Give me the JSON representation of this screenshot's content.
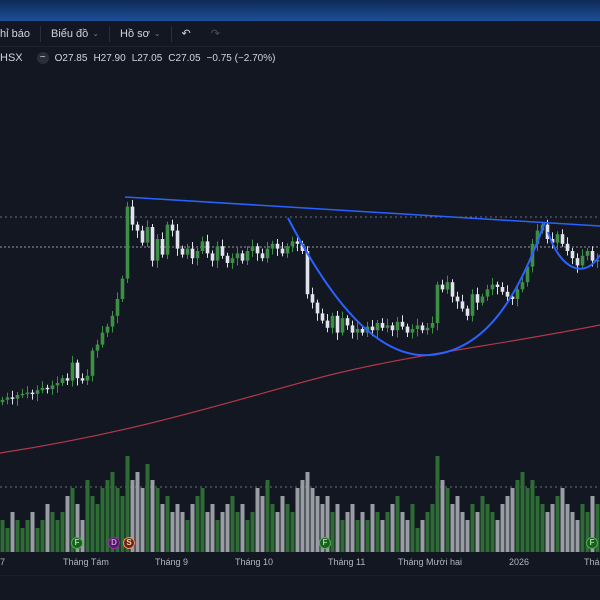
{
  "toolbar": {
    "indicators": "hỉ báo",
    "chart": "Biểu đồ",
    "profile": "Hồ sơ",
    "undo": "↶",
    "redo": "↷"
  },
  "legend": {
    "symbol": "HSX",
    "open": "O27.85",
    "high": "H27.90",
    "low": "L27.05",
    "close": "C27.05",
    "change": "−0.75 (−2.70%)"
  },
  "colors": {
    "up": "#3d8f46",
    "down": "#e0e3eb",
    "trend": "#2962ff",
    "ma": "#b2374a"
  },
  "x_axis": [
    "7",
    "Tháng Tám",
    "Tháng 9",
    "Tháng 10",
    "Tháng 11",
    "Tháng Mười hai",
    "2026",
    "Thán"
  ],
  "events": [
    "F",
    "D",
    "S",
    "F",
    "F"
  ],
  "closes": [
    15.4,
    15.6,
    15.5,
    15.8,
    15.9,
    16.0,
    15.9,
    16.2,
    16.4,
    16.3,
    16.6,
    16.8,
    17.2,
    17.0,
    18.5,
    17.2,
    17.0,
    17.4,
    19.5,
    20.0,
    21.0,
    21.5,
    22.4,
    23.8,
    25.5,
    31.5,
    30.0,
    29.5,
    28.5,
    29.8,
    27.0,
    28.8,
    27.5,
    30.0,
    29.5,
    28.0,
    27.5,
    28.0,
    27.2,
    27.8,
    28.6,
    27.6,
    27.0,
    28.2,
    27.4,
    26.8,
    27.2,
    27.6,
    27.0,
    27.8,
    28.2,
    27.6,
    27.2,
    28.0,
    28.4,
    28.0,
    27.6,
    28.2,
    28.6,
    28.4,
    27.8,
    24.2,
    23.5,
    22.6,
    22.0,
    21.4,
    22.4,
    21.0,
    22.2,
    21.6,
    21.0,
    21.3,
    21.0,
    21.5,
    21.2,
    21.8,
    21.4,
    21.6,
    21.2,
    21.9,
    21.5,
    21.0,
    21.3,
    21.6,
    21.2,
    21.4,
    21.8,
    25.0,
    24.6,
    25.2,
    24.0,
    23.6,
    23.0,
    22.4,
    24.2,
    23.5,
    24.0,
    24.6,
    25.0,
    24.8,
    24.4,
    24.0,
    23.8,
    24.6,
    25.2,
    26.5,
    28.4,
    29.5,
    30.0,
    28.8,
    28.5,
    29.2,
    28.4,
    27.8,
    27.2,
    26.6,
    27.4,
    27.8,
    27.0,
    27.05
  ],
  "volumes": [
    4,
    3,
    5,
    4,
    3,
    4,
    5,
    3,
    4,
    6,
    5,
    4,
    5,
    7,
    8,
    6,
    4,
    9,
    7,
    6,
    8,
    9,
    10,
    8,
    7,
    12,
    9,
    10,
    8,
    11,
    9,
    8,
    6,
    7,
    5,
    6,
    5,
    4,
    6,
    7,
    8,
    5,
    6,
    4,
    5,
    6,
    7,
    5,
    6,
    4,
    5,
    8,
    7,
    9,
    6,
    5,
    7,
    6,
    5,
    8,
    9,
    10,
    8,
    7,
    6,
    7,
    5,
    6,
    4,
    5,
    6,
    4,
    5,
    4,
    6,
    5,
    4,
    5,
    6,
    7,
    5,
    4,
    6,
    3,
    4,
    5,
    6,
    12,
    9,
    8,
    6,
    7,
    5,
    4,
    6,
    5,
    7,
    6,
    5,
    4,
    6,
    7,
    8,
    9,
    10,
    8,
    9,
    7,
    6,
    5,
    6,
    7,
    8,
    6,
    5,
    4,
    6,
    5,
    7,
    6
  ]
}
